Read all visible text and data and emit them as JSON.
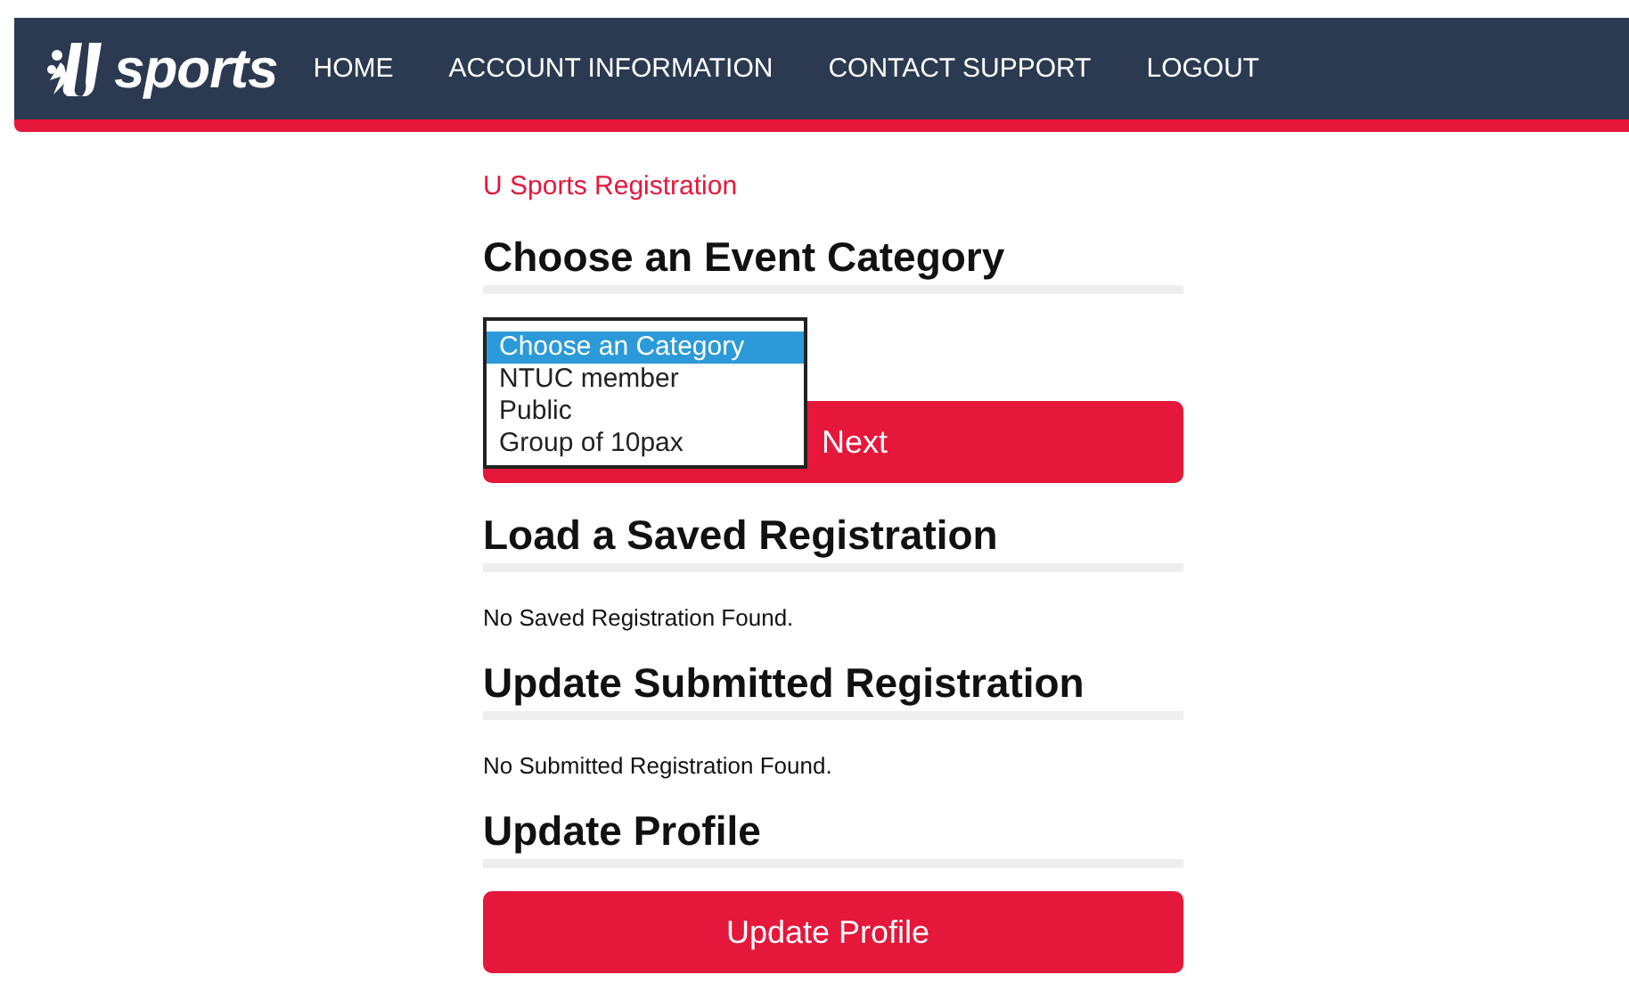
{
  "header": {
    "logo_text": "sports",
    "nav": [
      {
        "label": "HOME"
      },
      {
        "label": "ACCOUNT INFORMATION"
      },
      {
        "label": "CONTACT SUPPORT"
      },
      {
        "label": "LOGOUT"
      }
    ]
  },
  "breadcrumb": "U Sports Registration",
  "sections": [
    {
      "kind": "select",
      "title": "Choose an Event Category",
      "button": "Next",
      "dropdown": {
        "options": [
          {
            "label": "Choose an Category",
            "selected": true
          },
          {
            "label": "NTUC member",
            "selected": false
          },
          {
            "label": "Public",
            "selected": false
          },
          {
            "label": "Group of 10pax",
            "selected": false
          }
        ]
      }
    },
    {
      "kind": "message",
      "title": "Load a Saved Registration",
      "message": "No Saved Registration Found."
    },
    {
      "kind": "message",
      "title": "Update Submitted Registration",
      "message": "No Submitted Registration Found."
    },
    {
      "kind": "button",
      "title": "Update Profile",
      "button": "Update Profile"
    }
  ]
}
